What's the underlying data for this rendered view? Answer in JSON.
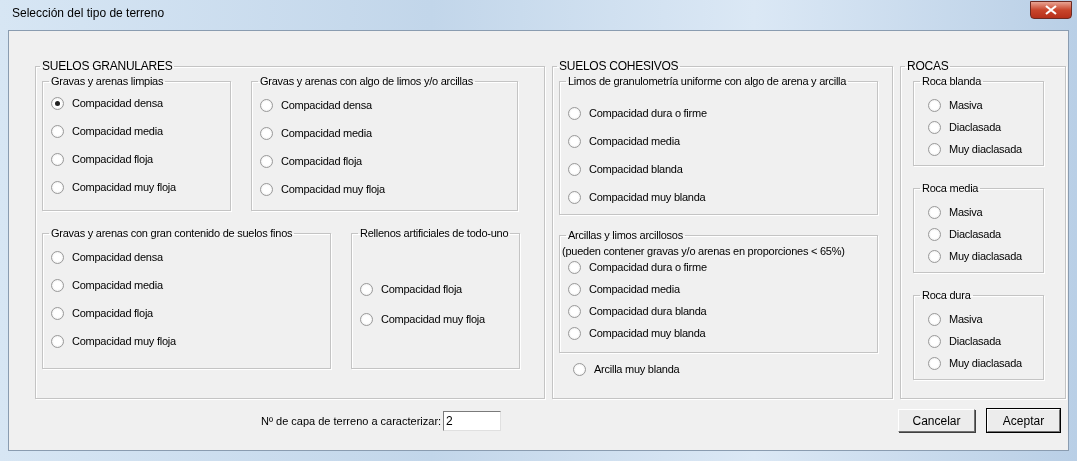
{
  "window": {
    "title": "Selección del tipo de terreno"
  },
  "sections": [
    {
      "title": "SUELOS GRANULARES",
      "items": [
        {
          "kind": "group",
          "title": "Gravas y arenas limpias",
          "options": [
            {
              "label": "Compacidad densa",
              "selected": true
            },
            {
              "label": "Compacidad media",
              "selected": false
            },
            {
              "label": "Compacidad floja",
              "selected": false
            },
            {
              "label": "Compacidad muy floja",
              "selected": false
            }
          ]
        },
        {
          "kind": "group",
          "title": "Gravas y arenas con algo de limos y/o arcillas",
          "options": [
            {
              "label": "Compacidad densa",
              "selected": false
            },
            {
              "label": "Compacidad media",
              "selected": false
            },
            {
              "label": "Compacidad floja",
              "selected": false
            },
            {
              "label": "Compacidad muy floja",
              "selected": false
            }
          ]
        },
        {
          "kind": "group",
          "title": "Gravas y arenas con gran contenido de suelos finos",
          "options": [
            {
              "label": "Compacidad densa",
              "selected": false
            },
            {
              "label": "Compacidad media",
              "selected": false
            },
            {
              "label": "Compacidad floja",
              "selected": false
            },
            {
              "label": "Compacidad muy floja",
              "selected": false
            }
          ]
        },
        {
          "kind": "group",
          "title": "Rellenos artificiales de todo-uno",
          "options": [
            {
              "label": "Compacidad floja",
              "selected": false
            },
            {
              "label": "Compacidad muy floja",
              "selected": false
            }
          ]
        }
      ]
    },
    {
      "title": "SUELOS COHESIVOS",
      "items": [
        {
          "kind": "group",
          "title": "Limos de granulometría uniforme con algo de arena y arcilla",
          "options": [
            {
              "label": "Compacidad dura o firme",
              "selected": false
            },
            {
              "label": "Compacidad media",
              "selected": false
            },
            {
              "label": "Compacidad blanda",
              "selected": false
            },
            {
              "label": "Compacidad muy blanda",
              "selected": false
            }
          ]
        },
        {
          "kind": "group",
          "title": "Arcillas y limos arcillosos",
          "note": "(pueden contener gravas y/o arenas en proporciones < 65%)",
          "options": [
            {
              "label": "Compacidad dura o firme",
              "selected": false
            },
            {
              "label": "Compacidad media",
              "selected": false
            },
            {
              "label": "Compacidad dura blanda",
              "selected": false
            },
            {
              "label": "Compacidad muy blanda",
              "selected": false
            }
          ]
        },
        {
          "kind": "option",
          "label": "Arcilla muy blanda",
          "selected": false
        }
      ]
    },
    {
      "title": "ROCAS",
      "items": [
        {
          "kind": "group",
          "title": "Roca blanda",
          "options": [
            {
              "label": "Masiva",
              "selected": false
            },
            {
              "label": "Diaclasada",
              "selected": false
            },
            {
              "label": "Muy diaclasada",
              "selected": false
            }
          ]
        },
        {
          "kind": "group",
          "title": "Roca media",
          "options": [
            {
              "label": "Masiva",
              "selected": false
            },
            {
              "label": "Diaclasada",
              "selected": false
            },
            {
              "label": "Muy diaclasada",
              "selected": false
            }
          ]
        },
        {
          "kind": "group",
          "title": "Roca dura",
          "options": [
            {
              "label": "Masiva",
              "selected": false
            },
            {
              "label": "Diaclasada",
              "selected": false
            },
            {
              "label": "Muy diaclasada",
              "selected": false
            }
          ]
        }
      ]
    }
  ],
  "layer_field": {
    "label": "Nº de capa de terreno a caracterizar:",
    "value": "2"
  },
  "buttons": [
    {
      "label": "Cancelar",
      "default": false
    },
    {
      "label": "Aceptar",
      "default": true
    }
  ]
}
